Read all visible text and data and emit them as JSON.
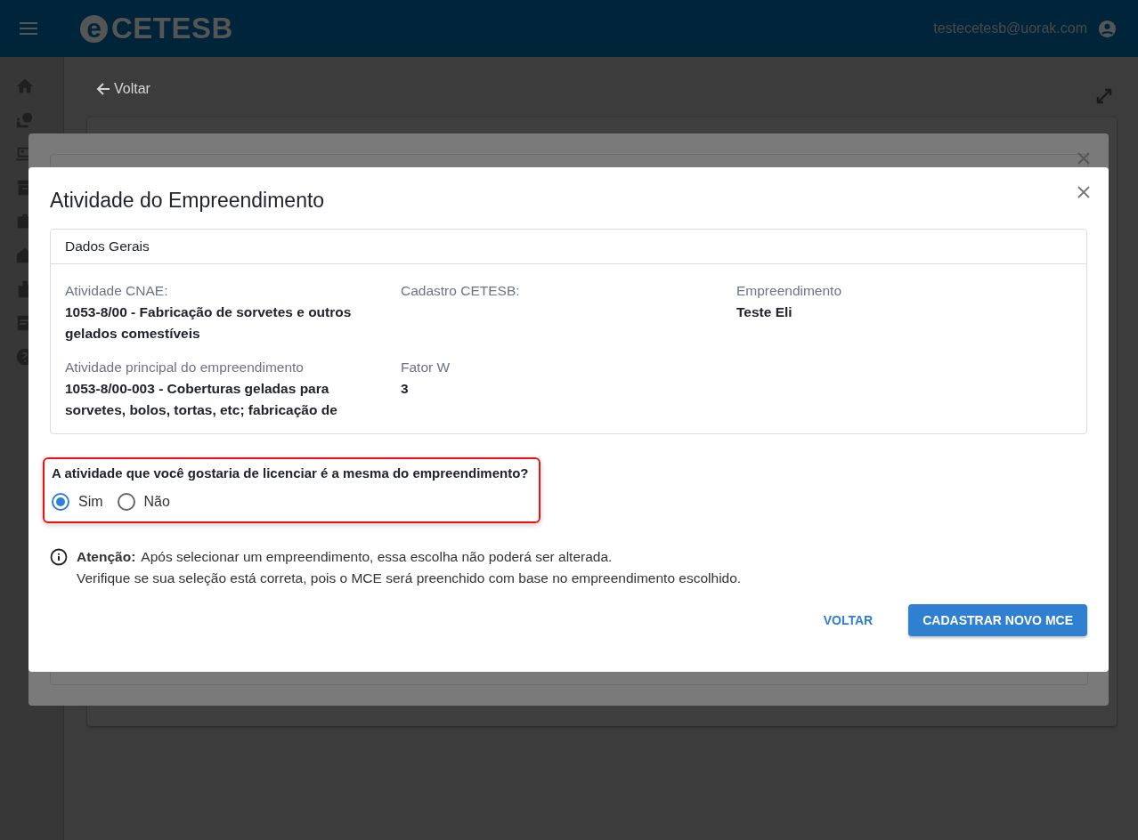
{
  "app_bar": {
    "logo_mark": "e",
    "logo_text": "CETESB",
    "user_email": "testecetesb@uorak.com"
  },
  "page": {
    "back_link": "Voltar"
  },
  "dialog": {
    "title": "Atividade do Empreendimento",
    "card": {
      "title": "Dados Gerais",
      "fields": [
        {
          "label": "Atividade CNAE:",
          "value": "1053-8/00 - Fabricação de sorvetes e outros gelados comestíveis"
        },
        {
          "label": "Cadastro CETESB:"
        },
        {
          "label": "Empreendimento",
          "value": "Teste Eli"
        },
        {
          "label": "Atividade principal do empreendimento",
          "value": "1053-8/00-003 - Coberturas geladas para sorvetes, bolos, tortas, etc; fabricação de"
        },
        {
          "label": "Fator W",
          "value": "3"
        }
      ]
    },
    "question": {
      "text": "A atividade que você gostaria de licenciar é a mesma do empreendimento?",
      "highlighted": true,
      "options": [
        {
          "label": "Sim",
          "selected": true
        },
        {
          "label": "Não",
          "selected": false
        }
      ]
    },
    "notice": {
      "label": "Atenção:",
      "lines": [
        "Após selecionar um empreendimento, essa escolha não poderá ser alterada.",
        "Verifique se sua seleção está correta, pois o MCE será preenchido com base no empreendimento escolhido."
      ]
    },
    "buttons": [
      {
        "label": "VOLTAR",
        "kind": "text"
      },
      {
        "label": "CADASTRAR NOVO MCE",
        "kind": "contained"
      }
    ]
  }
}
